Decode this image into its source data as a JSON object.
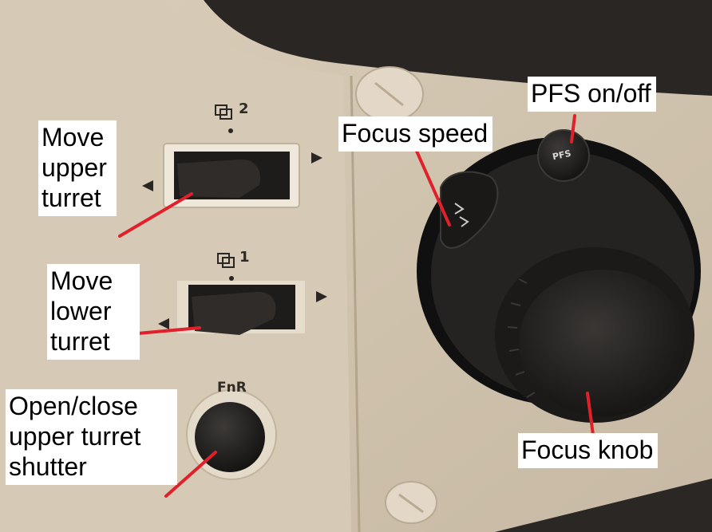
{
  "labels": {
    "pfs": [
      "PFS on/off"
    ],
    "focus_speed": [
      "Focus speed"
    ],
    "upper_turret": [
      "Move",
      "upper",
      "turret"
    ],
    "lower_turret": [
      "Move",
      "lower",
      "turret"
    ],
    "shutter": [
      "Open/close",
      "upper turret",
      "shutter"
    ],
    "focus_knob": [
      "Focus knob"
    ]
  },
  "markings": {
    "upper_index": "2",
    "lower_index": "1",
    "fnr": "FnR",
    "pfs_button": "PFS"
  },
  "icons": {
    "turret": "turret-icon",
    "arrow_left": "arrow-left-icon",
    "arrow_right": "arrow-right-icon",
    "speed": "focus-speed-icon"
  },
  "colors": {
    "annotation_line": "#e0202a",
    "panel": "#d8ccb9",
    "knob": "#1f1d1c",
    "label_bg": "#ffffff"
  }
}
